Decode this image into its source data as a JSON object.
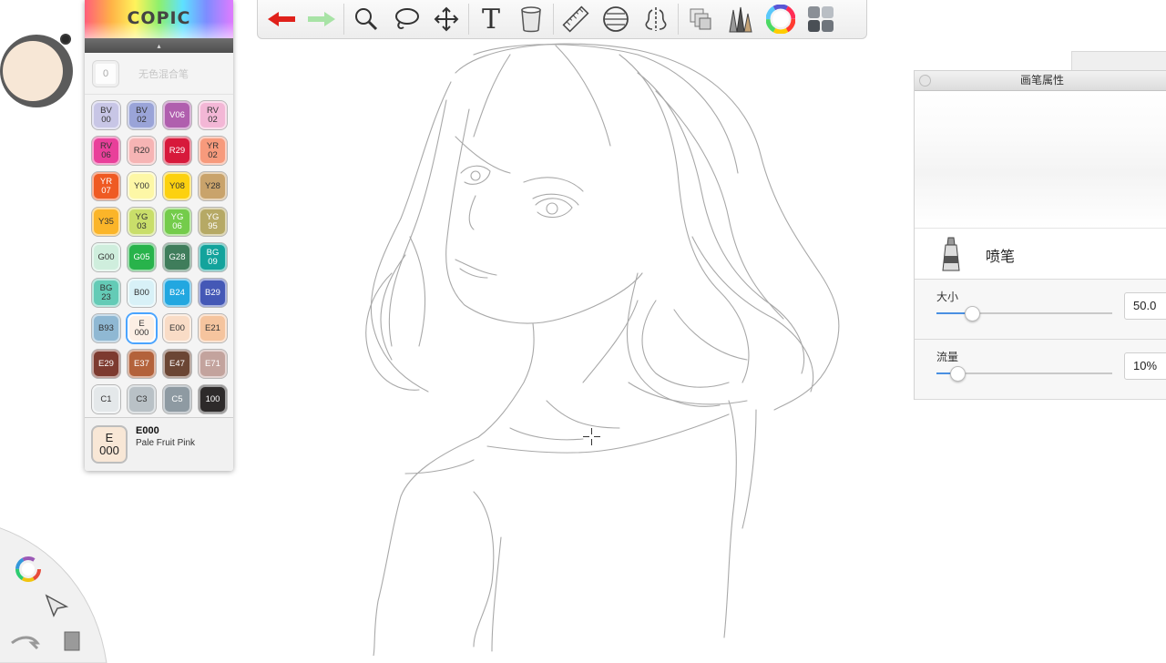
{
  "toolbar": {
    "tools": [
      {
        "name": "undo-icon",
        "label": "Undo"
      },
      {
        "name": "redo-icon",
        "label": "Redo"
      },
      {
        "name": "zoom-icon",
        "label": "Zoom"
      },
      {
        "name": "lasso-icon",
        "label": "Lasso"
      },
      {
        "name": "move-icon",
        "label": "Transform"
      },
      {
        "name": "text-icon",
        "label": "Text"
      },
      {
        "name": "fill-bucket-icon",
        "label": "Fill"
      },
      {
        "name": "ruler-icon",
        "label": "Ruler"
      },
      {
        "name": "perspective-icon",
        "label": "Perspective"
      },
      {
        "name": "symmetry-icon",
        "label": "Symmetry"
      },
      {
        "name": "layers-icon",
        "label": "Layers"
      },
      {
        "name": "brush-library-icon",
        "label": "Brush library"
      },
      {
        "name": "color-wheel-icon",
        "label": "Color"
      },
      {
        "name": "copic-palette-icon",
        "label": "Copic library"
      }
    ],
    "text_tool_glyph": "T"
  },
  "current_color": "#f7e7d6",
  "palette": {
    "logo": "COPIC",
    "blender_code": "0",
    "blender_label": "无色混合笔",
    "swatches": [
      {
        "code": "BV\n00",
        "color": "#c8c6e6",
        "text": "#333"
      },
      {
        "code": "BV\n02",
        "color": "#9aa4d8",
        "text": "#333"
      },
      {
        "code": "V06",
        "color": "#b05fae",
        "text": "#fff"
      },
      {
        "code": "RV\n02",
        "color": "#f3b7d6",
        "text": "#333"
      },
      {
        "code": "RV\n06",
        "color": "#e93f9a",
        "text": "#333"
      },
      {
        "code": "R20",
        "color": "#f6b4b4",
        "text": "#333"
      },
      {
        "code": "R29",
        "color": "#d7193b",
        "text": "#fff"
      },
      {
        "code": "YR\n02",
        "color": "#f79a7c",
        "text": "#333"
      },
      {
        "code": "YR\n07",
        "color": "#ef5a23",
        "text": "#fff"
      },
      {
        "code": "Y00",
        "color": "#fdf7a6",
        "text": "#333"
      },
      {
        "code": "Y08",
        "color": "#fcd10f",
        "text": "#333"
      },
      {
        "code": "Y28",
        "color": "#c9a36b",
        "text": "#333"
      },
      {
        "code": "Y35",
        "color": "#fbb529",
        "text": "#333"
      },
      {
        "code": "YG\n03",
        "color": "#c9de6a",
        "text": "#333"
      },
      {
        "code": "YG\n06",
        "color": "#74cc4b",
        "text": "#fff"
      },
      {
        "code": "YG\n95",
        "color": "#b6a965",
        "text": "#fff"
      },
      {
        "code": "G00",
        "color": "#cfeedd",
        "text": "#333"
      },
      {
        "code": "G05",
        "color": "#28b34b",
        "text": "#fff"
      },
      {
        "code": "G28",
        "color": "#3f7d5b",
        "text": "#fff"
      },
      {
        "code": "BG\n09",
        "color": "#13a39c",
        "text": "#fff"
      },
      {
        "code": "BG\n23",
        "color": "#64cbb6",
        "text": "#333"
      },
      {
        "code": "B00",
        "color": "#d8f1f7",
        "text": "#333"
      },
      {
        "code": "B24",
        "color": "#22a7e0",
        "text": "#fff"
      },
      {
        "code": "B29",
        "color": "#4458b6",
        "text": "#fff"
      },
      {
        "code": "B93",
        "color": "#8fb8d3",
        "text": "#333"
      },
      {
        "code": "E\n000",
        "color": "#fcefe4",
        "text": "#333",
        "selected": true
      },
      {
        "code": "E00",
        "color": "#f9dcc6",
        "text": "#333"
      },
      {
        "code": "E21",
        "color": "#f5c49e",
        "text": "#333"
      },
      {
        "code": "E29",
        "color": "#7d3a2f",
        "text": "#fff"
      },
      {
        "code": "E37",
        "color": "#b3623b",
        "text": "#fff"
      },
      {
        "code": "E47",
        "color": "#6b4634",
        "text": "#fff"
      },
      {
        "code": "E71",
        "color": "#c3a39d",
        "text": "#fff"
      },
      {
        "code": "C1",
        "color": "#e4e8ea",
        "text": "#333"
      },
      {
        "code": "C3",
        "color": "#b9c1c6",
        "text": "#333"
      },
      {
        "code": "C5",
        "color": "#8e9aa2",
        "text": "#fff"
      },
      {
        "code": "100",
        "color": "#2d2a2a",
        "text": "#fff"
      }
    ],
    "selected": {
      "chip": "E\n000",
      "code": "E000",
      "name": "Pale Fruit Pink",
      "color": "#f8e7d6"
    }
  },
  "brush_panel": {
    "title": "画笔属性",
    "brush_name": "喷笔",
    "size": {
      "label": "大小",
      "value": "50.0",
      "fraction": 0.2
    },
    "flow": {
      "label": "流量",
      "value": "10%",
      "fraction": 0.12
    }
  }
}
